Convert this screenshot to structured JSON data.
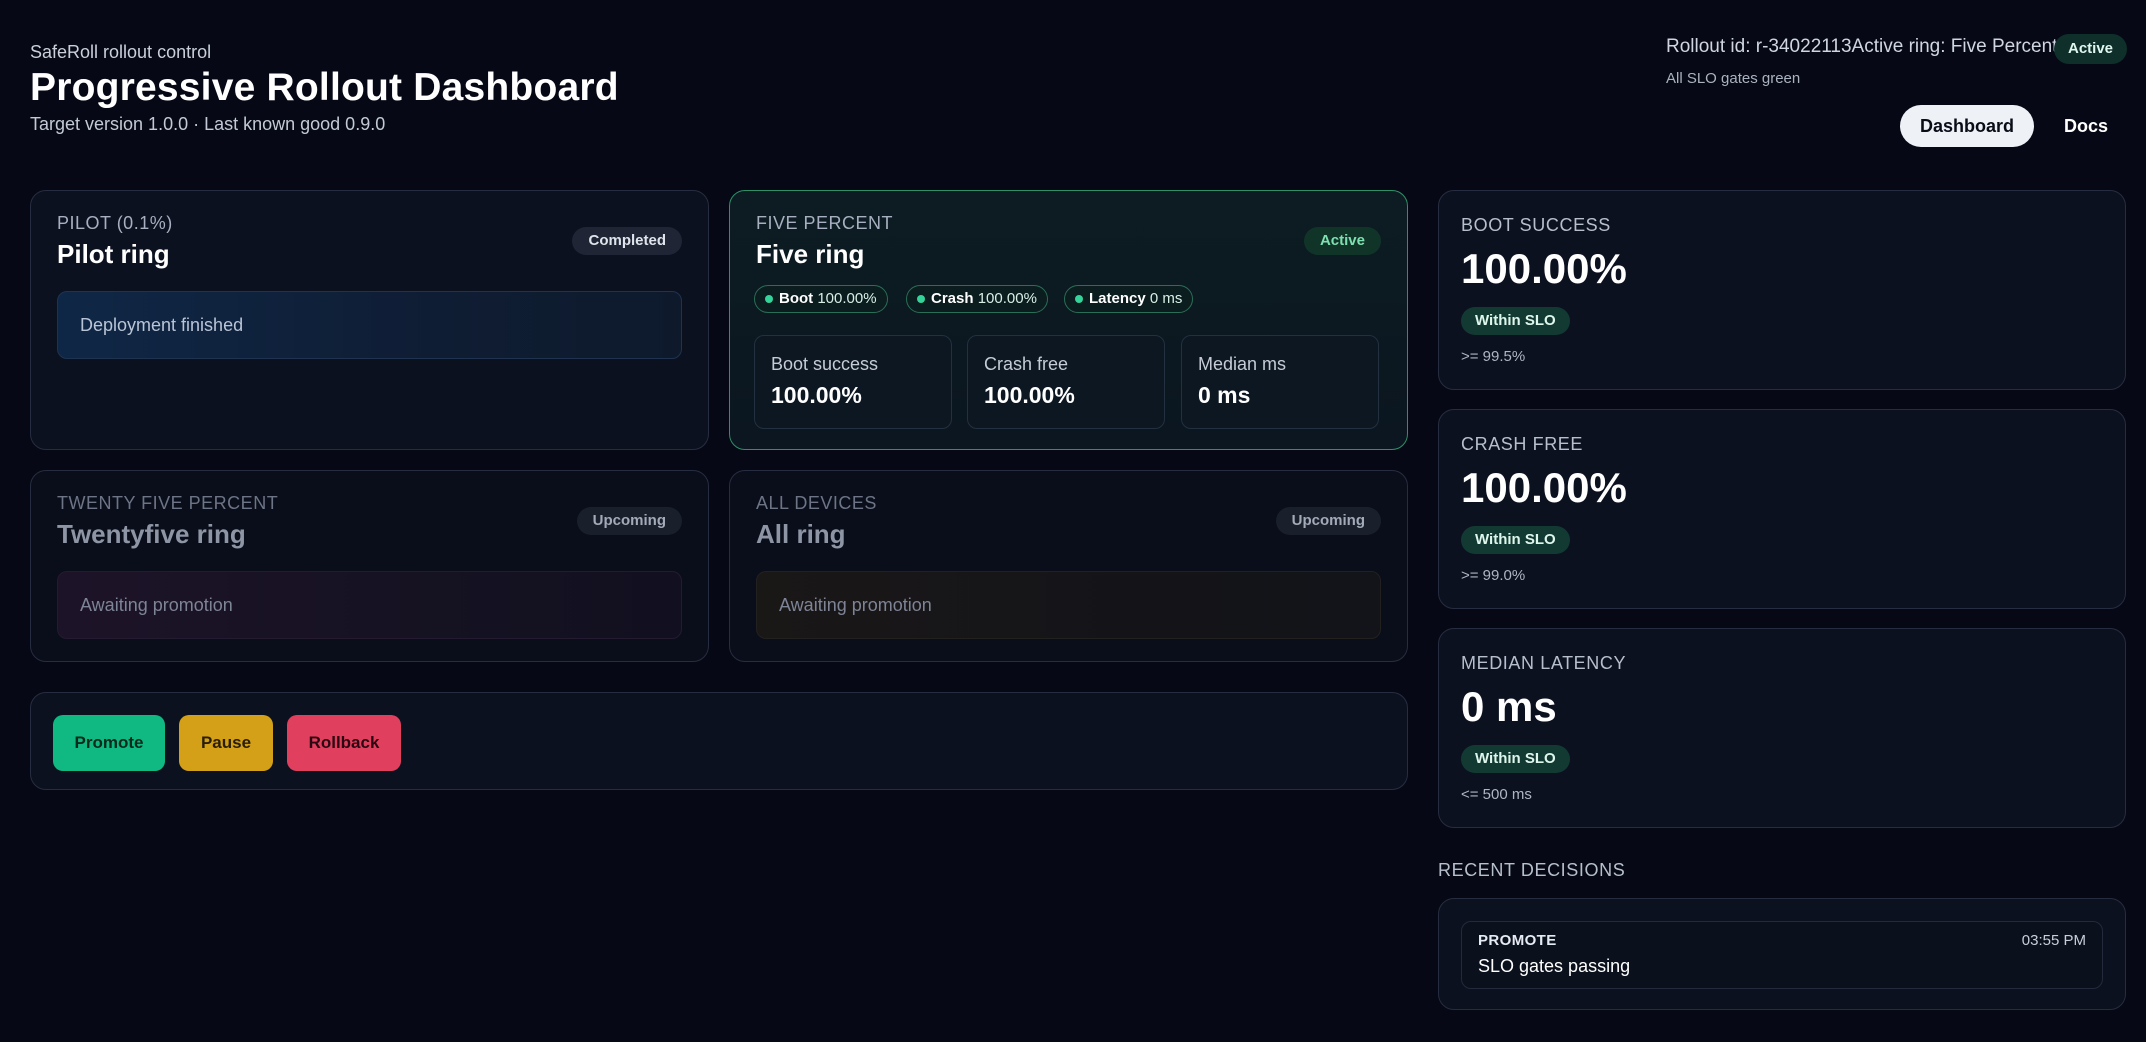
{
  "header": {
    "brand": "SafeRoll rollout control",
    "title": "Progressive Rollout Dashboard",
    "subtitle": "Target version 1.0.0 · Last known good 0.9.0",
    "rollout_line": "Rollout id: r-34022113Active ring: Five Percent",
    "status_badge": "Active",
    "gates_note": "All SLO gates green",
    "nav": {
      "dashboard": "Dashboard",
      "docs": "Docs"
    }
  },
  "rings": [
    {
      "eyebrow": "PILOT (0.1%)",
      "title": "Pilot ring",
      "badge": "Completed",
      "status": "Deployment finished"
    },
    {
      "eyebrow": "FIVE PERCENT",
      "title": "Five ring",
      "badge": "Active",
      "chips": [
        {
          "label": "Boot",
          "value": "100.00%"
        },
        {
          "label": "Crash",
          "value": "100.00%"
        },
        {
          "label": "Latency",
          "value": "0 ms"
        }
      ],
      "stats": [
        {
          "label": "Boot success",
          "value": "100.00%"
        },
        {
          "label": "Crash free",
          "value": "100.00%"
        },
        {
          "label": "Median ms",
          "value": "0 ms"
        }
      ]
    },
    {
      "eyebrow": "TWENTY FIVE PERCENT",
      "title": "Twentyfive ring",
      "badge": "Upcoming",
      "status": "Awaiting promotion"
    },
    {
      "eyebrow": "ALL DEVICES",
      "title": "All ring",
      "badge": "Upcoming",
      "status": "Awaiting promotion"
    }
  ],
  "actions": {
    "promote": "Promote",
    "pause": "Pause",
    "rollback": "Rollback"
  },
  "metrics": [
    {
      "eyebrow": "BOOT SUCCESS",
      "value": "100.00%",
      "badge": "Within SLO",
      "threshold": ">= 99.5%"
    },
    {
      "eyebrow": "CRASH FREE",
      "value": "100.00%",
      "badge": "Within SLO",
      "threshold": ">= 99.0%"
    },
    {
      "eyebrow": "MEDIAN LATENCY",
      "value": "0 ms",
      "badge": "Within SLO",
      "threshold": "<= 500 ms"
    }
  ],
  "recent": {
    "title": "RECENT DECISIONS",
    "items": [
      {
        "type": "PROMOTE",
        "time": "03:55 PM",
        "message": "SLO gates passing"
      }
    ]
  },
  "colors": {
    "background": "#060915",
    "accent_green": "#34d399",
    "promote": "#10b981",
    "pause": "#d4a017",
    "rollback": "#e0405e"
  }
}
